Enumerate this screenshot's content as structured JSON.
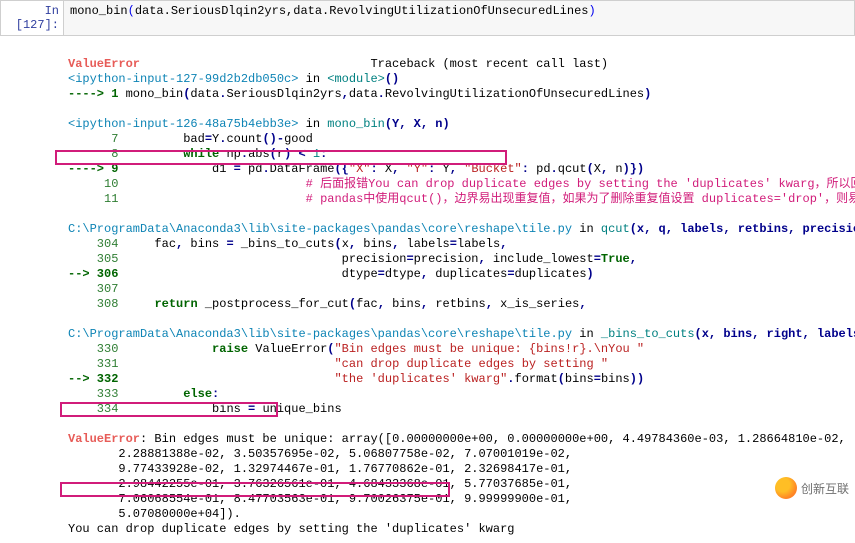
{
  "cell": {
    "prompt_label": "In [127]:",
    "code_line": "mono_bin(data.SeriousDlqin2yrs,data.RevolvingUtilizationOfUnsecuredLines)"
  },
  "traceback": {
    "header_error": "ValueError",
    "header_trace": "Traceback (most recent call last)",
    "frame1_loc": "<ipython-input-127-99d2b2db050c>",
    "frame1_in": " in ",
    "frame1_mod": "<module>",
    "frame1_paren": "()",
    "frame1_arrow": "----> 1 ",
    "frame1_call": "mono_bin(data.SeriousDlqin2yrs,data.RevolvingUtilizationOfUnsecuredLines)",
    "frame2_loc": "<ipython-input-126-48a75b4ebb3e>",
    "frame2_in": " in ",
    "frame2_fn": "mono_bin",
    "frame2_sig": "(Y, X, n)",
    "frame2_l7_no": "      7",
    "frame2_l7": "         bad=Y.count()-good",
    "frame2_l8_no": "      8",
    "frame2_l8": "         while np.abs(r) < 1:",
    "frame2_l9_arrow": "----> 9",
    "frame2_l9": "             d1 = pd.DataFrame({\"X\": X, \"Y\": Y, \"Bucket\": pd.qcut(X, n)})",
    "frame2_l10_no": "     10",
    "frame2_l10": "             # 后面报错You can drop duplicate edges by setting the 'duplicates' kwarg，所以回到这里补充duplicates参数",
    "frame2_l11_no": "     11",
    "frame2_l11": "             # pandas中使用qcut()，边界易出现重复值，如果为了删除重复值设置 duplicates='drop'，则易出现于分片个数少于指定个数的问题",
    "frame3_path": "C:\\ProgramData\\Anaconda3\\lib\\site-packages\\pandas\\core\\reshape\\tile.py",
    "frame3_in": " in ",
    "frame3_fn": "qcut",
    "frame3_sig": "(x, q, labels, retbins, precision, duplicates)",
    "frame3_l304_no": "    304",
    "frame3_l304": "     fac, bins = _bins_to_cuts(x, bins, labels=labels,",
    "frame3_l305_no": "    305",
    "frame3_l305": "                               precision=precision, include_lowest=True,",
    "frame3_l306_arrow": "--> 306",
    "frame3_l306": "                               dtype=dtype, duplicates=duplicates)",
    "frame3_l307_no": "    307",
    "frame3_l307": "",
    "frame3_l308_no": "    308",
    "frame3_l308": "     return _postprocess_for_cut(fac, bins, retbins, x_is_series,",
    "frame4_path": "C:\\ProgramData\\Anaconda3\\lib\\site-packages\\pandas\\core\\reshape\\tile.py",
    "frame4_in": " in ",
    "frame4_fn": "_bins_to_cuts",
    "frame4_sig": "(x, bins, right, labels, precision, include_lowest, dtype, duplicates)",
    "frame4_l330_no": "    330",
    "frame4_l330": "             raise ValueError(\"Bin edges must be unique: {bins!r}.\\nYou \"",
    "frame4_l331_no": "    331",
    "frame4_l331": "                              \"can drop duplicate edges by setting \"",
    "frame4_l332_arrow": "--> 332",
    "frame4_l332": "                              \"the 'duplicates' kwarg\".format(bins=bins))",
    "frame4_l333_no": "    333",
    "frame4_l333": "         else:",
    "frame4_l334_no": "    334",
    "frame4_l334": "             bins = unique_bins",
    "final_error": "ValueError",
    "final_msg_lead": ": Bin edges must be unique:",
    "final_msg_arr1": " array([0.00000000e+00, 0.00000000e+00, 4.49784360e-03, 1.28664810e-02,",
    "final_msg_arr2": "       2.28881388e-02, 3.50357695e-02, 5.06807758e-02, 7.07001019e-02,",
    "final_msg_arr3": "       9.77433928e-02, 1.32974467e-01, 1.76770862e-01, 2.32698417e-01,",
    "final_msg_arr4": "       2.98442255e-01, 3.76326561e-01, 4.68433368e-01, 5.77037685e-01,",
    "final_msg_arr5": "       7.06068554e-01, 8.47703563e-01, 9.70026375e-01, 9.99999900e-01,",
    "final_msg_arr6": "       5.07080000e+04]).",
    "final_msg_tail": "You can drop duplicate edges by setting the 'duplicates' kwarg"
  },
  "watermark": {
    "text": "创新互联"
  }
}
